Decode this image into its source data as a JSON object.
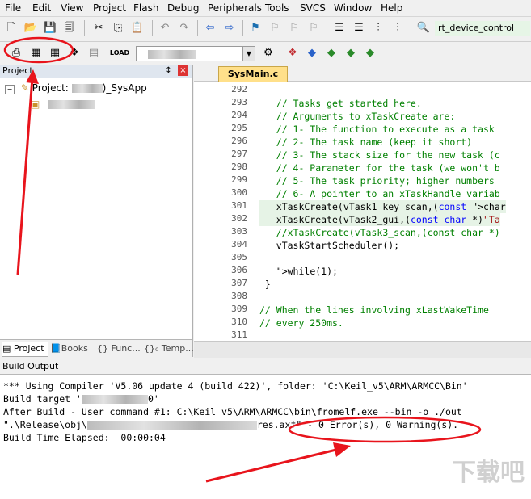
{
  "menu": [
    "File",
    "Edit",
    "View",
    "Project",
    "Flash",
    "Debug",
    "Peripherals",
    "Tools",
    "SVCS",
    "Window",
    "Help"
  ],
  "toolbar": {
    "function_combo_value": "rt_device_control",
    "target_combo_value": ""
  },
  "project_panel": {
    "title": "Project",
    "pin_glyph": "↕",
    "close_glyph": "×",
    "root_label": "Project: ",
    "root_suffix": ")_SysApp",
    "tabs": [
      "Project",
      "Books",
      "{} Func...",
      "{}₀ Temp..."
    ]
  },
  "editor": {
    "file_tab": "SysMain.c",
    "line_numbers": [
      "292",
      "293",
      "294",
      "295",
      "296",
      "297",
      "298",
      "299",
      "300",
      "301",
      "302",
      "303",
      "304",
      "305",
      "306",
      "307",
      "308",
      "309",
      "310",
      "311"
    ],
    "lines": [
      "",
      "   // Tasks get started here.",
      "   // Arguments to xTaskCreate are:",
      "   // 1- The function to execute as a task",
      "   // 2- The task name (keep it short)",
      "   // 3- The stack size for the new task (c",
      "   // 4- Parameter for the task (we won't b",
      "   // 5- The task priority; higher numbers",
      "   // 6- A pointer to an xTaskHandle variab",
      "   xTaskCreate(vTask1_key_scan,(const char",
      "   xTaskCreate(vTask2_gui,(const char *)\"Ta",
      "   //xTaskCreate(vTask3_scan,(const char *)",
      "   vTaskStartScheduler();",
      "",
      "   while(1);",
      " }",
      "",
      "// When the lines involving xLastWakeTime",
      "// every 250ms."
    ]
  },
  "build_output": {
    "title": "Build Output",
    "lines": [
      "*** Using Compiler 'V5.06 update 4 (build 422)', folder: 'C:\\Keil_v5\\ARM\\ARMCC\\Bin'",
      "Build target '",
      "After Build - User command #1: C:\\Keil_v5\\ARM\\ARMCC\\bin\\fromelf.exe --bin -o ./out",
      "\".\\Release\\obj\\",
      "Build Time Elapsed:  00:00:04"
    ],
    "target_suffix": "0'",
    "axf_suffix": "res.axf\" - 0 Error(s), 0 Warning(s)."
  },
  "watermark": "下载吧",
  "colors": {
    "annotation_red": "#e8141c",
    "comment": "#008000",
    "keyword": "#0000ff"
  }
}
